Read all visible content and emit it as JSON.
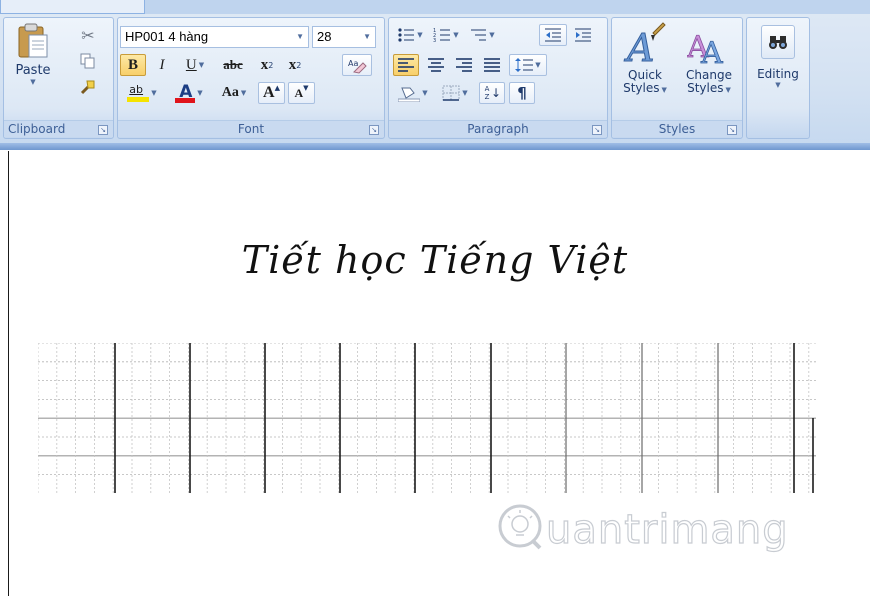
{
  "clipboard": {
    "paste_label": "Paste",
    "group_label": "Clipboard"
  },
  "font": {
    "family": "HP001 4 hàng",
    "size": "28",
    "group_label": "Font",
    "bold": "B",
    "italic": "I",
    "underline": "U",
    "strikethrough": "abc",
    "subscript_base": "x",
    "subscript_mark": "2",
    "superscript_base": "x",
    "superscript_mark": "2",
    "highlight": "ab",
    "font_color": "A",
    "change_case": "Aa",
    "grow_font": "A",
    "shrink_font": "A",
    "clear_formatting": "Aa",
    "font_color_value": "#e0141b",
    "highlight_color_value": "#f5e300"
  },
  "paragraph": {
    "group_label": "Paragraph",
    "sort": "A Z",
    "pilcrow": "¶"
  },
  "styles": {
    "quick_styles_line1": "Quick",
    "quick_styles_line2": "Styles",
    "change_styles_line1": "Change",
    "change_styles_line2": "Styles",
    "group_label": "Styles"
  },
  "editing": {
    "label": "Editing"
  },
  "document": {
    "title": "Tiết học Tiếng Việt"
  },
  "watermark": {
    "text": "uantrimang",
    "initial": "Q"
  }
}
